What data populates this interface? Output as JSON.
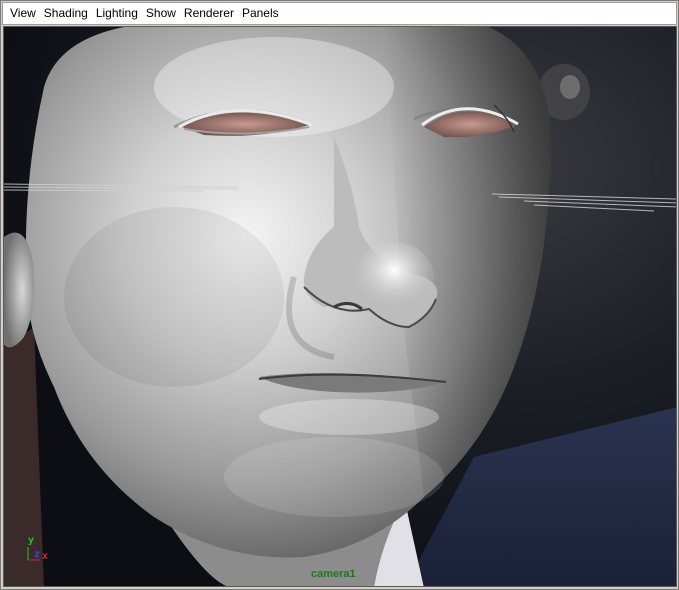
{
  "menubar": {
    "items": [
      "View",
      "Shading",
      "Lighting",
      "Show",
      "Renderer",
      "Panels"
    ]
  },
  "viewport": {
    "camera_label": "camera1",
    "axis": {
      "y": "y",
      "z": "z",
      "x": "x"
    }
  },
  "colors": {
    "menubar_bg": "#ffffff",
    "viewport_bg": "#151820",
    "axis_y": "#22c42a",
    "axis_z": "#2a4cff",
    "axis_x": "#e02020",
    "camera_label": "#1a7a1a"
  }
}
